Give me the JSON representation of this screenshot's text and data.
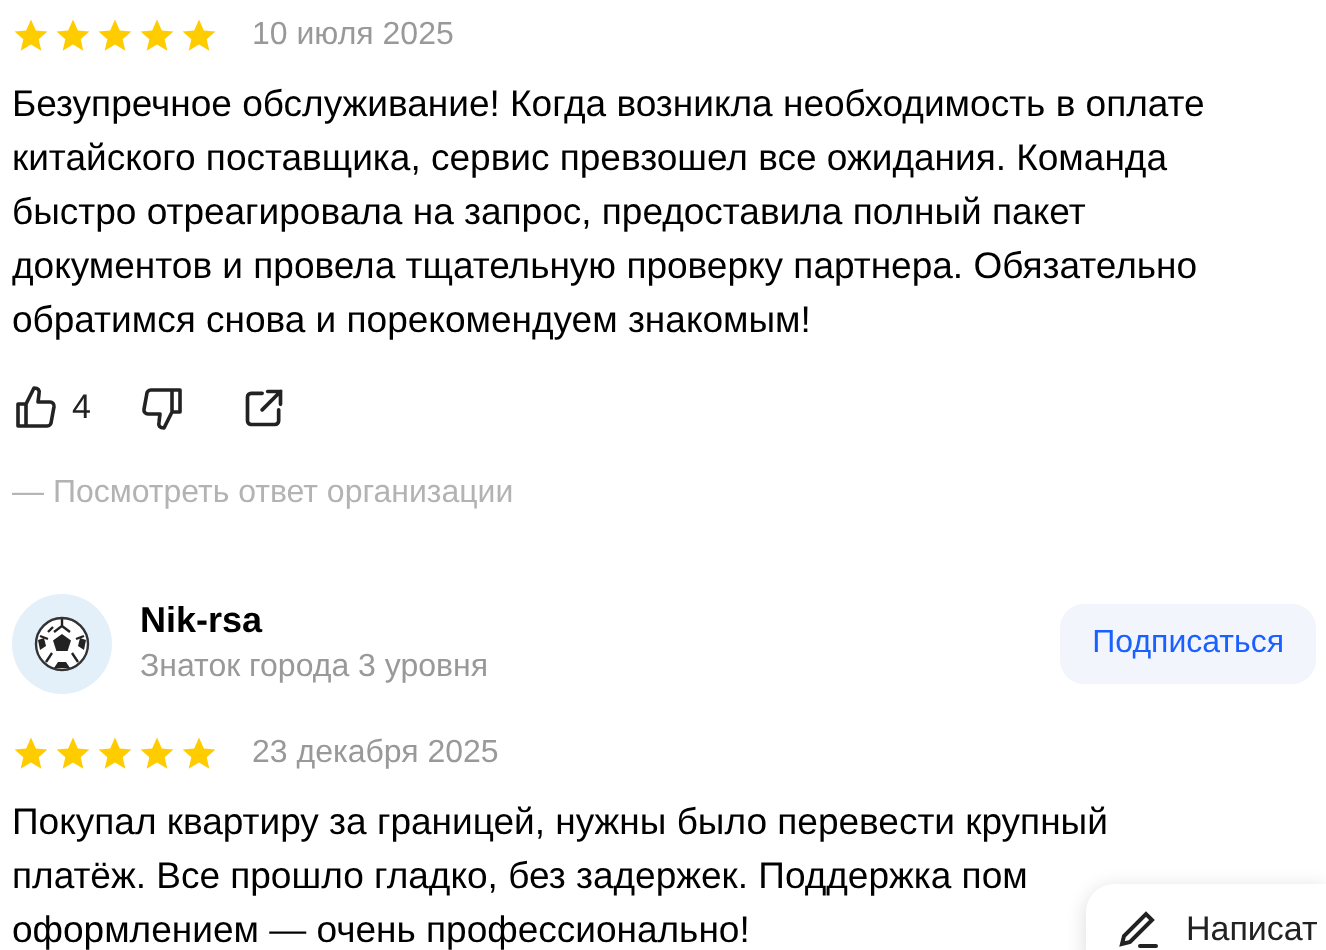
{
  "reviews": [
    {
      "stars": 5,
      "date": "10 июля 2025",
      "lines": [
        "Безупречное обслуживание! Когда возникла необходимость в оплате",
        "китайского поставщика, сервис превзошел все ожидания. Команда",
        "быстро отреагировала на запрос, предоставила полный пакет",
        "документов и провела тщательную проверку партнера. Обязательно",
        "обратимся снова и порекомендуем знакомым!"
      ],
      "likes": "4",
      "reply_link": "— Посмотреть ответ организации"
    },
    {
      "author": {
        "name": "Nik-rsa",
        "level": "Знаток города 3 уровня",
        "button": "Подписаться"
      },
      "stars": 5,
      "date": "23 декабря 2025",
      "lines": [
        "Покупал квартиру за границей, нужны было перевести крупный",
        "платёж. Все прошло гладко, без задержек. Поддержка пом",
        "оформлением — очень профессионально!"
      ]
    }
  ],
  "write_button": {
    "label": "Написат"
  }
}
